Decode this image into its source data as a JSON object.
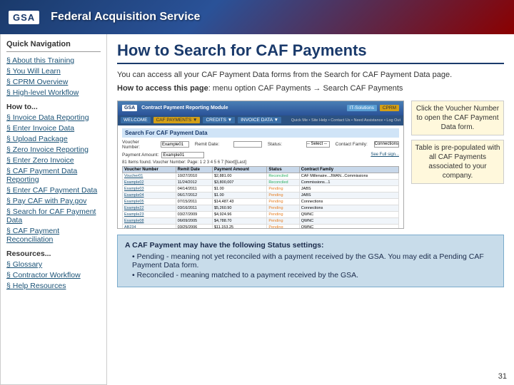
{
  "header": {
    "logo": "GSA",
    "title": "Federal Acquisition Service"
  },
  "sidebar": {
    "title": "Quick Navigation",
    "topLinks": [
      {
        "label": "About this Training"
      },
      {
        "label": "You Will Learn"
      },
      {
        "label": "CPRM Overview"
      },
      {
        "label": "High-level Workflow"
      }
    ],
    "howToTitle": "How to...",
    "howToLinks": [
      {
        "label": "Invoice Data Reporting"
      },
      {
        "label": "Enter Invoice Data"
      },
      {
        "label": "Upload Package"
      },
      {
        "label": "Zero Invoice Reporting"
      },
      {
        "label": "Enter Zero Invoice"
      },
      {
        "label": "CAF Payment Data Reporting"
      },
      {
        "label": "Enter CAF Payment Data"
      },
      {
        "label": "Pay CAF with Pay.gov"
      },
      {
        "label": "Search for CAF Payment Data"
      },
      {
        "label": "CAF Payment Reconciliation"
      }
    ],
    "resourcesTitle": "Resources...",
    "resourceLinks": [
      {
        "label": "Glossary"
      },
      {
        "label": "Contractor Workflow"
      },
      {
        "label": "Help Resources"
      }
    ]
  },
  "content": {
    "pageTitle": "How to Search for CAF Payments",
    "introParagraph1": "You can access all your CAF Payment Data forms from the Search for CAF Payment Data page.",
    "introAccess": "How to access this page",
    "introAccess2": ": menu option CAF Payments → Search CAF Payments",
    "mockScreen": {
      "logo": "GSA",
      "moduleTitle": "Contract Payment Reporting Module",
      "tabs": [
        "IT-Solutions",
        "CPRM"
      ],
      "navItems": [
        "WELCOME",
        "CAF PAYMENTS ▼",
        "CREDITS ▼",
        "INVOICE DATA ▼"
      ],
      "quickLinks": "Quick Me • Site Help • Contact Us • Need Assistance • Log Out",
      "sectionTitle": "Search For CAF Payment Data",
      "fields": [
        {
          "label": "Voucher Number:",
          "value": "Example01"
        },
        {
          "label": "Remit Date:",
          "value": ""
        },
        {
          "label": "Status:",
          "value": ""
        },
        {
          "label": "Contact Family:",
          "value": "Connections"
        }
      ],
      "paymentLabel": "Payment Amount:",
      "paymentValue": "Example01",
      "foundText": "81 Items found. Voucher Number: Page: 1 2 3 4 5 6 7 [Next][Last]",
      "tableHeaders": [
        "Voucher Number",
        "Remit Date",
        "Payment Amount",
        "Status",
        "Contract Family"
      ],
      "tableRows": [
        [
          "Voucher01",
          "10/27/2010",
          "$2,881.00",
          "Reconciled",
          "CAF Millenaire...JWAN...Commissions"
        ],
        [
          "Example02",
          "11/24/2012",
          "$3,800,007",
          "Reconciled",
          "Commissions...1"
        ],
        [
          "Example03",
          "04/14/2011",
          "$1.00",
          "Pending",
          "JABS"
        ],
        [
          "Example04",
          "06/17/2012",
          "$1.00",
          "Pending",
          "JABS"
        ],
        [
          "Example05",
          "07/15/2011",
          "$14,487.43",
          "Pending",
          "Connections"
        ],
        [
          "Example22",
          "03/16/2011",
          "$5,260.90",
          "Pending",
          "Connections"
        ],
        [
          "Example23",
          "03/27/2009",
          "$4,924.96",
          "Pending",
          "QWNC"
        ],
        [
          "Example08",
          "06/09/2005",
          "$4,788.70",
          "Pending",
          "QWNC"
        ],
        [
          "AB234",
          "03/25/2006",
          "$11,153.25",
          "Pending",
          "QWNC"
        ]
      ]
    },
    "captionText": "Click the Voucher Number to open the CAF Payment Data form.",
    "tableCaption": "Table is pre-populated with all CAF Payments associated to your company.",
    "bottomNote": {
      "title": "A CAF Payment may have the following Status settings:",
      "items": [
        "Pending - meaning not yet reconciled with a payment received by the GSA. You may edit a Pending CAF Payment Data form.",
        "Reconciled - meaning matched to a payment received by the GSA."
      ]
    }
  },
  "footer": {
    "pageNumber": "31"
  }
}
